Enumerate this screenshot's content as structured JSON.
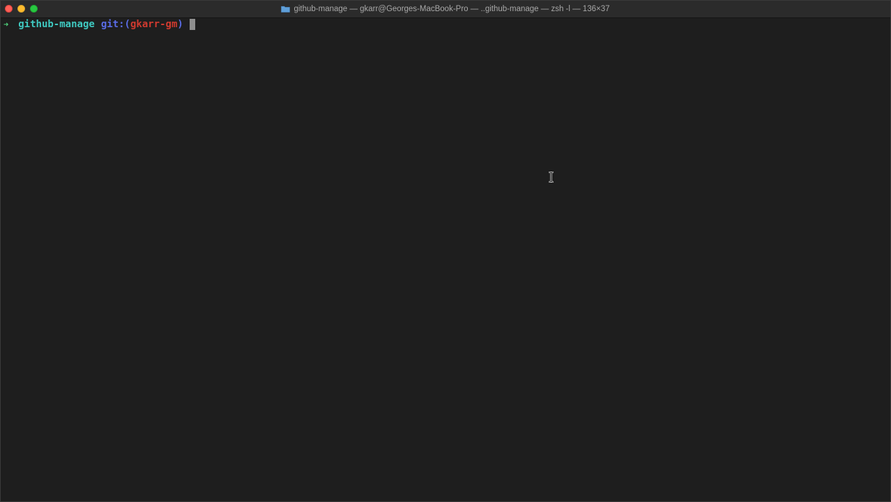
{
  "window": {
    "title": "github-manage — gkarr@Georges-MacBook-Pro — ..github-manage — zsh -l — 136×37"
  },
  "terminal": {
    "prompt_arrow": "➜",
    "directory": "github-manage",
    "git_prefix": "git:",
    "paren_open": "(",
    "branch": "gkarr-gm",
    "paren_close": ")"
  },
  "colors": {
    "background": "#1e1e1e",
    "arrow": "#4fd07a",
    "directory": "#3fc8c0",
    "git": "#5a6ce6",
    "branch": "#d03a2f"
  }
}
